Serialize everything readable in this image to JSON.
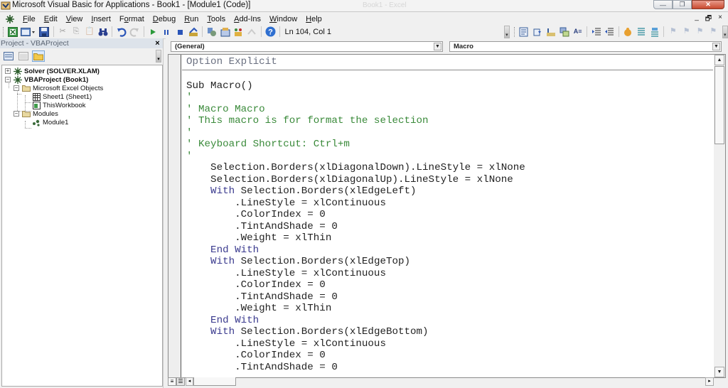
{
  "window": {
    "title": "Microsoft Visual Basic for Applications - Book1 - [Module1 (Code)]",
    "background_title": "Book1 - Excel",
    "controls": {
      "minimize": "—",
      "restore": "❐",
      "close": "✕"
    }
  },
  "menubar": {
    "items": [
      {
        "label": "File",
        "accel": "F"
      },
      {
        "label": "Edit",
        "accel": "E"
      },
      {
        "label": "View",
        "accel": "V"
      },
      {
        "label": "Insert",
        "accel": "I"
      },
      {
        "label": "Format",
        "accel": "o"
      },
      {
        "label": "Debug",
        "accel": "D"
      },
      {
        "label": "Run",
        "accel": "R"
      },
      {
        "label": "Tools",
        "accel": "T"
      },
      {
        "label": "Add-Ins",
        "accel": "A"
      },
      {
        "label": "Window",
        "accel": "W"
      },
      {
        "label": "Help",
        "accel": "H"
      }
    ],
    "mdi_controls": {
      "minimize": "_",
      "restore": "🗗",
      "close": "×"
    }
  },
  "toolbar": {
    "cursor_position": "Ln 104, Col 1",
    "standard_buttons": [
      {
        "name": "view-excel",
        "enabled": true
      },
      {
        "name": "insert-userform",
        "enabled": true
      },
      {
        "name": "save",
        "enabled": true
      },
      {
        "name": "cut",
        "enabled": false
      },
      {
        "name": "copy",
        "enabled": false
      },
      {
        "name": "paste",
        "enabled": false
      },
      {
        "name": "find",
        "enabled": true
      },
      {
        "name": "undo",
        "enabled": true
      },
      {
        "name": "redo",
        "enabled": false
      },
      {
        "name": "run",
        "enabled": true
      },
      {
        "name": "break",
        "enabled": true
      },
      {
        "name": "reset",
        "enabled": true
      },
      {
        "name": "design-mode",
        "enabled": true
      },
      {
        "name": "project-explorer",
        "enabled": true
      },
      {
        "name": "properties-window",
        "enabled": true
      },
      {
        "name": "object-browser",
        "enabled": true
      },
      {
        "name": "toolbox",
        "enabled": false
      },
      {
        "name": "help",
        "enabled": true
      }
    ],
    "edit_buttons": [
      {
        "name": "list-properties",
        "enabled": true
      },
      {
        "name": "list-constants",
        "enabled": true
      },
      {
        "name": "quick-info",
        "enabled": true
      },
      {
        "name": "parameter-info",
        "enabled": true
      },
      {
        "name": "complete-word",
        "enabled": true
      },
      {
        "name": "indent",
        "enabled": true
      },
      {
        "name": "outdent",
        "enabled": true
      },
      {
        "name": "toggle-breakpoint",
        "enabled": true
      },
      {
        "name": "comment-block",
        "enabled": true
      },
      {
        "name": "uncomment-block",
        "enabled": true
      },
      {
        "name": "toggle-bookmark",
        "enabled": false
      },
      {
        "name": "next-bookmark",
        "enabled": false
      },
      {
        "name": "previous-bookmark",
        "enabled": false
      },
      {
        "name": "clear-all-bookmarks",
        "enabled": false
      }
    ]
  },
  "project_panel": {
    "title": "Project - VBAProject",
    "close": "×",
    "tree": [
      {
        "label": "Solver (SOLVER.XLAM)",
        "bold": true,
        "toggle": "+",
        "icon": "vba-project-icon",
        "level": 0
      },
      {
        "label": "VBAProject (Book1)",
        "bold": true,
        "toggle": "−",
        "icon": "vba-project-icon",
        "level": 0
      },
      {
        "label": "Microsoft Excel Objects",
        "bold": false,
        "toggle": "−",
        "icon": "folder-icon",
        "level": 1
      },
      {
        "label": "Sheet1 (Sheet1)",
        "bold": false,
        "toggle": null,
        "icon": "worksheet-icon",
        "level": 2
      },
      {
        "label": "ThisWorkbook",
        "bold": false,
        "toggle": null,
        "icon": "workbook-icon",
        "level": 2
      },
      {
        "label": "Modules",
        "bold": false,
        "toggle": "−",
        "icon": "folder-icon",
        "level": 1
      },
      {
        "label": "Module1",
        "bold": false,
        "toggle": null,
        "icon": "module-icon",
        "level": 2
      }
    ]
  },
  "code_window": {
    "object_dropdown": "(General)",
    "procedure_dropdown": "Macro",
    "declarations": "Option Explicit",
    "lines": [
      {
        "type": "normal",
        "text": "Sub Macro()"
      },
      {
        "type": "comment",
        "text": "'"
      },
      {
        "type": "comment",
        "text": "' Macro Macro"
      },
      {
        "type": "comment",
        "text": "' This macro is for format the selection"
      },
      {
        "type": "comment",
        "text": "'"
      },
      {
        "type": "comment",
        "text": "' Keyboard Shortcut: Ctrl+m"
      },
      {
        "type": "comment",
        "text": "'"
      },
      {
        "type": "normal",
        "text": "    Selection.Borders(xlDiagonalDown).LineStyle = xlNone"
      },
      {
        "type": "normal",
        "text": "    Selection.Borders(xlDiagonalUp).LineStyle = xlNone"
      },
      {
        "type": "with",
        "kw": "    With",
        "text": " Selection.Borders(xlEdgeLeft)"
      },
      {
        "type": "normal",
        "text": "        .LineStyle = xlContinuous"
      },
      {
        "type": "normal",
        "text": "        .ColorIndex = 0"
      },
      {
        "type": "normal",
        "text": "        .TintAndShade = 0"
      },
      {
        "type": "normal",
        "text": "        .Weight = xlThin"
      },
      {
        "type": "endwith",
        "kw": "    End With",
        "text": ""
      },
      {
        "type": "with",
        "kw": "    With",
        "text": " Selection.Borders(xlEdgeTop)"
      },
      {
        "type": "normal",
        "text": "        .LineStyle = xlContinuous"
      },
      {
        "type": "normal",
        "text": "        .ColorIndex = 0"
      },
      {
        "type": "normal",
        "text": "        .TintAndShade = 0"
      },
      {
        "type": "normal",
        "text": "        .Weight = xlThin"
      },
      {
        "type": "endwith",
        "kw": "    End With",
        "text": ""
      },
      {
        "type": "with",
        "kw": "    With",
        "text": " Selection.Borders(xlEdgeBottom)"
      },
      {
        "type": "normal",
        "text": "        .LineStyle = xlContinuous"
      },
      {
        "type": "normal",
        "text": "        .ColorIndex = 0"
      },
      {
        "type": "normal",
        "text": "        .TintAndShade = 0"
      }
    ]
  },
  "colors": {
    "comment": "#3a8a3a",
    "keyword": "#3a3a8e",
    "code_text": "#222222"
  }
}
